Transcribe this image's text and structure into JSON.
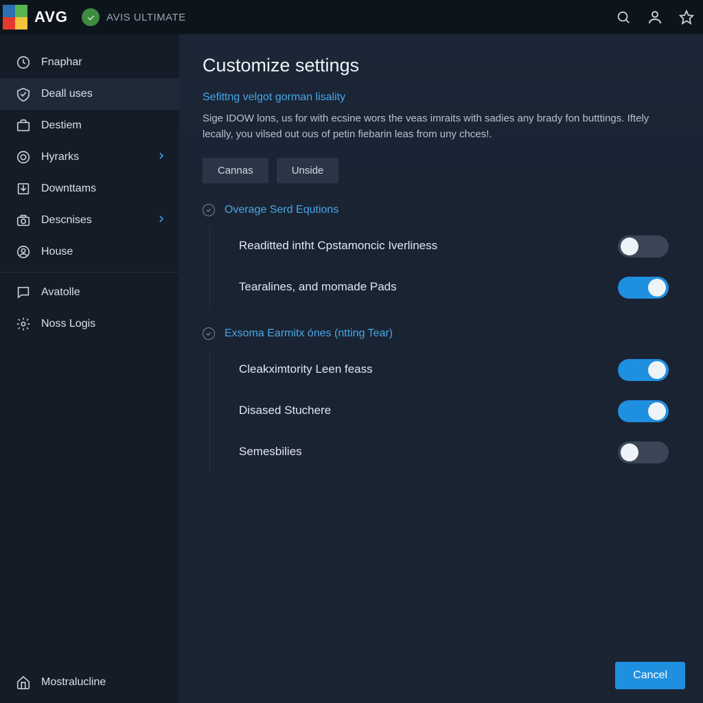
{
  "header": {
    "brand": "AVG",
    "product": "AVIS ULTIMATE"
  },
  "sidebar": {
    "items": [
      {
        "label": "Fnaphar",
        "icon": "clock",
        "chevron": false
      },
      {
        "label": "Deall uses",
        "icon": "check",
        "chevron": false,
        "active": true
      },
      {
        "label": "Destiem",
        "icon": "briefcase",
        "chevron": false
      },
      {
        "label": "Hyrarks",
        "icon": "target",
        "chevron": true
      },
      {
        "label": "Downttams",
        "icon": "download",
        "chevron": false
      },
      {
        "label": "Descnises",
        "icon": "camera",
        "chevron": true
      },
      {
        "label": "House",
        "icon": "person",
        "chevron": false
      }
    ],
    "secondary": [
      {
        "label": "Avatolle",
        "icon": "chat"
      },
      {
        "label": "Noss Logis",
        "icon": "gear"
      }
    ],
    "footer_label": "Mostralucline"
  },
  "page": {
    "title": "Customize settings",
    "subtitle": "Sefittng velgot gorman lisality",
    "description": "Sige IDOW lons, us for with ecsine wors the veas imraits with sadies any brady fon butttings. Iftely lecally, you vilsed out ous of petin fiebarin leas from uny chces!.",
    "buttons": {
      "cannas": "Cannas",
      "unside": "Unside"
    },
    "groups": [
      {
        "title": "Overage Serd Equtions",
        "settings": [
          {
            "label": "Readitted intht Cpstamoncic Iverliness",
            "on": false
          },
          {
            "label": "Tearalines, and momade Pads",
            "on": true
          }
        ]
      },
      {
        "title": "Exsoma Earmitx ónes (ntting Tear)",
        "settings": [
          {
            "label": "Cleakximtority Leen feass",
            "on": true
          },
          {
            "label": "Disased Stuchere",
            "on": true
          },
          {
            "label": "Semesbilies",
            "on": false
          }
        ]
      }
    ],
    "cancel": "Cancel"
  }
}
